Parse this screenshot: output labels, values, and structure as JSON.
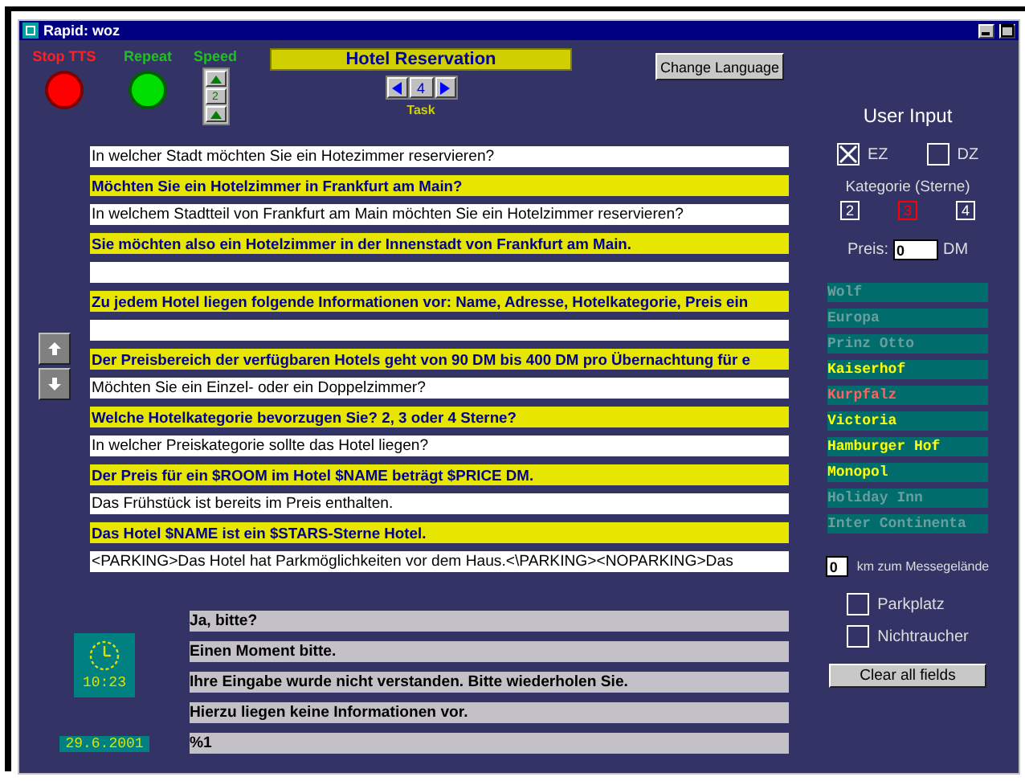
{
  "window": {
    "title": "Rapid: woz"
  },
  "controls": {
    "stop": "Stop TTS",
    "repeat": "Repeat",
    "speed": {
      "label": "Speed",
      "value": "2"
    },
    "title": "Hotel Reservation",
    "task": {
      "label": "Task",
      "value": "4"
    },
    "change_language": "Change Language"
  },
  "prompts": [
    {
      "text": "In welcher Stadt möchten Sie ein Hotezimmer reservieren?",
      "highlighted": false
    },
    {
      "text": "Möchten Sie ein Hotelzimmer in Frankfurt am Main?",
      "highlighted": true
    },
    {
      "text": "In welchem Stadtteil von Frankfurt am Main möchten Sie ein Hotelzimmer reservieren?",
      "highlighted": false
    },
    {
      "text": "Sie möchten also ein Hotelzimmer in der Innenstadt von Frankfurt am Main.",
      "highlighted": true
    },
    {
      "highlighted": false
    },
    {
      "text": "Zu jedem Hotel liegen folgende Informationen vor: Name, Adresse, Hotelkategorie, Preis ein",
      "highlighted": true
    },
    {
      "highlighted": false
    },
    {
      "text": "Der Preisbereich der verfügbaren Hotels geht von 90 DM bis 400 DM pro Übernachtung für e",
      "highlighted": true
    },
    {
      "text": "Möchten Sie ein Einzel- oder ein Doppelzimmer?",
      "highlighted": false
    },
    {
      "text": "Welche Hotelkategorie bevorzugen Sie? 2, 3 oder 4 Sterne?",
      "highlighted": true
    },
    {
      "text": "In welcher Preiskategorie sollte das Hotel liegen?",
      "highlighted": false
    },
    {
      "text": "Der Preis für ein $ROOM im Hotel $NAME beträgt $PRICE DM.",
      "highlighted": true
    },
    {
      "text": "Das Frühstück ist bereits im Preis enthalten.",
      "highlighted": false
    },
    {
      "text": "Das Hotel $NAME ist ein $STARS-Sterne Hotel.",
      "highlighted": true
    },
    {
      "text": "<PARKING>Das Hotel hat Parkmöglichkeiten vor dem Haus.<\\PARKING><NOPARKING>Das",
      "highlighted": false
    }
  ],
  "system_prompts": [
    "Ja, bitte?",
    "Einen Moment bitte.",
    "Ihre Eingabe wurde nicht verstanden. Bitte wiederholen Sie.",
    "Hierzu liegen keine Informationen vor.",
    "%1"
  ],
  "clock": {
    "time": "10:23",
    "date": "29.6.2001"
  },
  "user_input": {
    "title": "User Input",
    "room_types": [
      {
        "label": "EZ",
        "checked": true
      },
      {
        "label": "DZ",
        "checked": false
      }
    ],
    "category_label": "Kategorie (Sterne)",
    "categories": [
      {
        "label": "2",
        "selected": false
      },
      {
        "label": "3",
        "selected": true
      },
      {
        "label": "4",
        "selected": false
      }
    ],
    "price": {
      "label": "Preis:",
      "value": "0",
      "unit": "DM"
    },
    "hotels": [
      {
        "name": "Wolf",
        "disabled": true,
        "selected": false
      },
      {
        "name": "Europa",
        "disabled": true,
        "selected": false
      },
      {
        "name": "Prinz Otto",
        "disabled": true,
        "selected": false
      },
      {
        "name": "Kaiserhof",
        "disabled": false,
        "selected": false
      },
      {
        "name": "Kurpfalz",
        "disabled": false,
        "selected": true
      },
      {
        "name": "Victoria",
        "disabled": false,
        "selected": false
      },
      {
        "name": "Hamburger Hof",
        "disabled": false,
        "selected": false
      },
      {
        "name": "Monopol",
        "disabled": false,
        "selected": false
      },
      {
        "name": "Holiday Inn",
        "disabled": true,
        "selected": false
      },
      {
        "name": "Inter Continenta",
        "disabled": true,
        "selected": false
      }
    ],
    "distance": {
      "value": "0",
      "label": "km zum Messegelände"
    },
    "options": [
      {
        "label": "Parkplatz",
        "checked": false
      },
      {
        "label": "Nichtraucher",
        "checked": false
      }
    ],
    "clear_button": "Clear all fields"
  }
}
